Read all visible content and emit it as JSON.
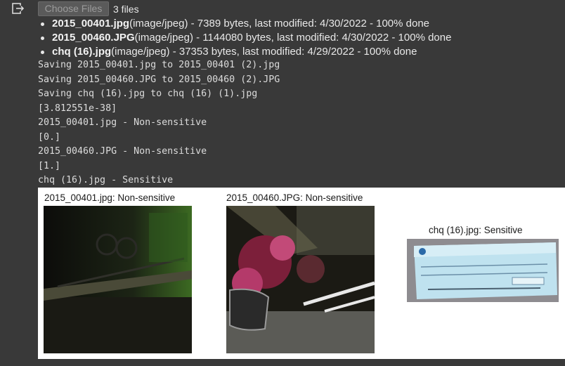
{
  "upload": {
    "button_label": "Choose Files",
    "count_text": "3 files"
  },
  "files": [
    {
      "name": "2015_00401.jpg",
      "details": "(image/jpeg) - 7389 bytes, last modified: 4/30/2022 - 100% done"
    },
    {
      "name": "2015_00460.JPG",
      "details": "(image/jpeg) - 1144080 bytes, last modified: 4/30/2022 - 100% done"
    },
    {
      "name": "chq (16).jpg",
      "details": "(image/jpeg) - 37353 bytes, last modified: 4/29/2022 - 100% done"
    }
  ],
  "log": [
    "Saving 2015_00401.jpg to 2015_00401 (2).jpg",
    "Saving 2015_00460.JPG to 2015_00460 (2).JPG",
    "Saving chq (16).jpg to chq (16) (1).jpg",
    "[3.812551e-38]",
    "2015_00401.jpg - Non-sensitive",
    "[0.]",
    "2015_00460.JPG - Non-sensitive",
    "[1.]",
    "chq (16).jpg - Sensitive"
  ],
  "figures": [
    {
      "title": "2015_00401.jpg: Non-sensitive",
      "content": "dark night photo of railing and bicycle"
    },
    {
      "title": "2015_00460.JPG: Non-sensitive",
      "content": "night photo of pink flowers and car mirror"
    },
    {
      "title": "chq (16).jpg: Sensitive",
      "content": "photo of a bank cheque"
    }
  ],
  "colors": {
    "background": "#393939",
    "text": "#e8e8e8",
    "button": "#5a5a5a",
    "figure_bg": "#ffffff"
  }
}
